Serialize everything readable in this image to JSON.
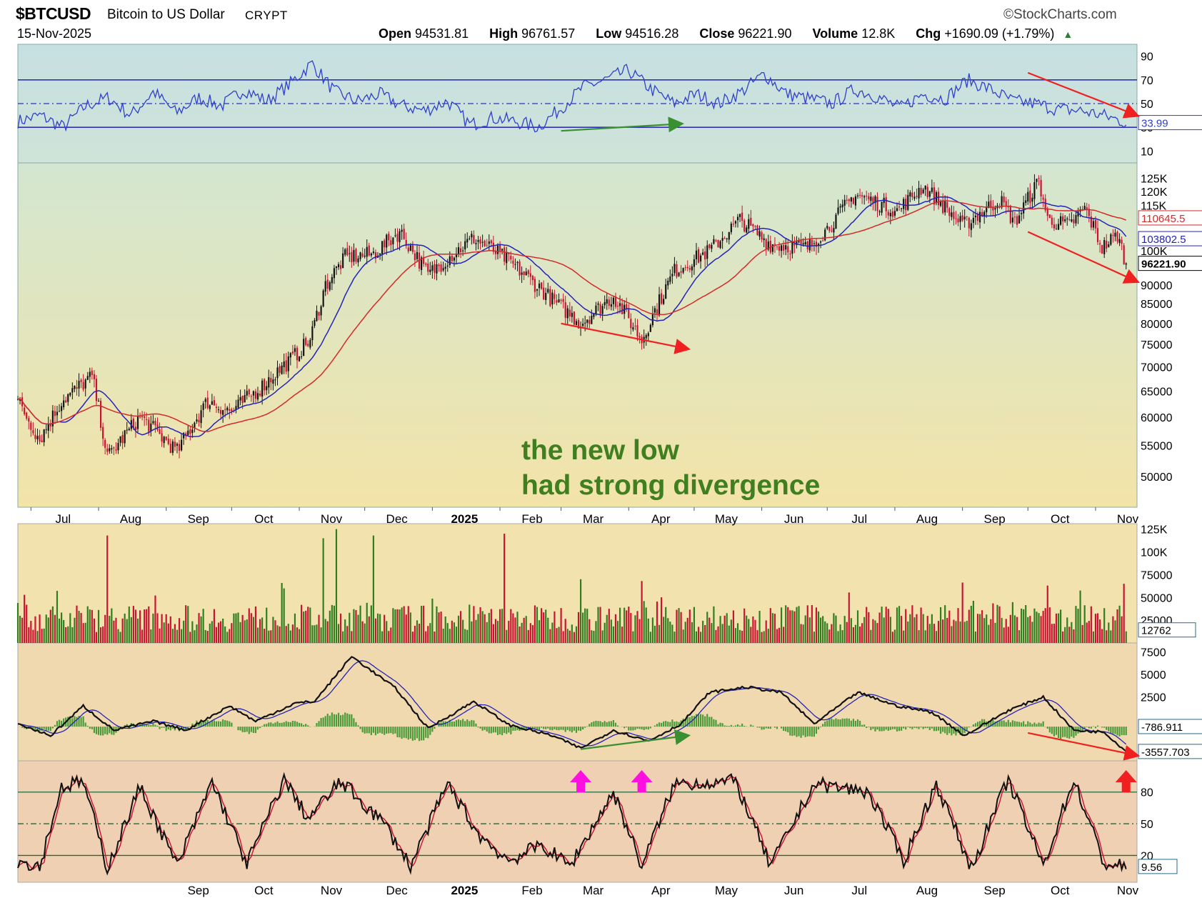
{
  "header": {
    "symbol": "$BTCUSD",
    "description": "Bitcoin to US Dollar",
    "exchange": "CRYPT",
    "date": "15-Nov-2025",
    "brand": "StockCharts.com",
    "open_label": "Open",
    "open": "94531.81",
    "high_label": "High",
    "high": "96761.57",
    "low_label": "Low",
    "low": "94516.28",
    "close_label": "Close",
    "close": "96221.90",
    "volume_label": "Volume",
    "volume": "12.8K",
    "chg_label": "Chg",
    "chg": "+1690.09 (+1.79%)"
  },
  "annotation": [
    "the new low",
    "had strong divergence"
  ],
  "colors": {
    "up": "#2e7d1e",
    "down": "#cc1030",
    "ma_short": "#2424b8",
    "ma_long": "#d42a2a",
    "rsi_line": "#3040c8",
    "arrow_red": "#f02020",
    "arrow_green": "#3a9030",
    "arrow_magenta": "#ff10e0",
    "macd_hist": "#4a9a3a"
  },
  "chart_data": [
    {
      "type": "line",
      "panel": "RSI",
      "ylim": [
        0,
        100
      ],
      "y_ticks": [
        10,
        30,
        50,
        70,
        90
      ],
      "reference_lines": [
        30,
        50,
        70
      ],
      "x": [
        "Jul",
        "Aug",
        "Sep",
        "Oct",
        "Nov",
        "Dec",
        "2025",
        "Feb",
        "Mar",
        "Apr",
        "May",
        "Jun",
        "Jul",
        "Aug",
        "Sep",
        "Oct",
        "Nov"
      ],
      "series": [
        {
          "values": [
            35,
            40,
            30,
            48,
            55,
            40,
            60,
            42,
            55,
            48,
            62,
            52,
            66,
            84,
            60,
            52,
            58,
            48,
            44,
            52,
            32,
            38,
            35,
            30,
            46,
            64,
            70,
            78,
            62,
            50,
            58,
            50,
            60,
            75,
            58,
            54,
            50,
            62,
            56,
            46,
            58,
            54,
            70,
            62,
            52,
            50,
            45,
            44,
            40,
            34
          ]
        }
      ],
      "last_value_label": "33.99",
      "trend_arrows": [
        {
          "color": "green",
          "from": [
            "2025-03-01",
            27
          ],
          "to": [
            "2025-04-25",
            33
          ]
        },
        {
          "color": "red",
          "from": [
            "2025-10-01",
            76
          ],
          "to": [
            "2025-11-20",
            40
          ]
        }
      ]
    },
    {
      "type": "candlestick",
      "panel": "Price",
      "scale": "log",
      "y_ticks": [
        "125K",
        "120K",
        "115K",
        "100K",
        "90000",
        "85000",
        "80000",
        "75000",
        "70000",
        "65000",
        "60000",
        "55000",
        "50000"
      ],
      "x_ticks": [
        "Jul",
        "Aug",
        "Sep",
        "Oct",
        "Nov",
        "Dec",
        "2025",
        "Feb",
        "Mar",
        "Apr",
        "May",
        "Jun",
        "Jul",
        "Aug",
        "Sep",
        "Oct",
        "Nov"
      ],
      "x_range": [
        "2024-06-25",
        "2025-11-20"
      ],
      "close_path": [
        [
          "2024-06-25",
          63000
        ],
        [
          "2024-07-05",
          56000
        ],
        [
          "2024-07-15",
          63000
        ],
        [
          "2024-07-29",
          68000
        ],
        [
          "2024-08-05",
          53000
        ],
        [
          "2024-08-20",
          60000
        ],
        [
          "2024-09-06",
          54000
        ],
        [
          "2024-09-20",
          63000
        ],
        [
          "2024-10-01",
          61000
        ],
        [
          "2024-10-15",
          66000
        ],
        [
          "2024-10-29",
          72000
        ],
        [
          "2024-11-06",
          76000
        ],
        [
          "2024-11-13",
          90000
        ],
        [
          "2024-11-22",
          98000
        ],
        [
          "2024-12-05",
          99000
        ],
        [
          "2024-12-17",
          106000
        ],
        [
          "2024-12-30",
          93000
        ],
        [
          "2025-01-20",
          104000
        ],
        [
          "2025-02-03",
          98000
        ],
        [
          "2025-02-25",
          86000
        ],
        [
          "2025-03-10",
          80000
        ],
        [
          "2025-03-25",
          87000
        ],
        [
          "2025-04-07",
          76000
        ],
        [
          "2025-04-22",
          94000
        ],
        [
          "2025-05-08",
          100000
        ],
        [
          "2025-05-22",
          110000
        ],
        [
          "2025-06-05",
          102000
        ],
        [
          "2025-06-22",
          101000
        ],
        [
          "2025-07-01",
          107000
        ],
        [
          "2025-07-14",
          119000
        ],
        [
          "2025-08-02",
          113000
        ],
        [
          "2025-08-14",
          122000
        ],
        [
          "2025-09-01",
          108000
        ],
        [
          "2025-09-18",
          117000
        ],
        [
          "2025-09-25",
          109000
        ],
        [
          "2025-10-06",
          124000
        ],
        [
          "2025-10-10",
          110000
        ],
        [
          "2025-10-20",
          108000
        ],
        [
          "2025-10-27",
          114000
        ],
        [
          "2025-11-04",
          101000
        ],
        [
          "2025-11-11",
          105000
        ],
        [
          "2025-11-15",
          96221.9
        ]
      ],
      "series": [
        {
          "indicator": "short moving average",
          "last_value_label": "103802.5"
        },
        {
          "indicator": "long moving average",
          "last_value_label": "110645.5"
        }
      ],
      "last_close_label": "96221.90",
      "trend_arrows": [
        {
          "color": "red",
          "from": [
            "2025-03-01",
            80000
          ],
          "to": [
            "2025-04-28",
            74000
          ]
        },
        {
          "color": "red",
          "from": [
            "2025-10-01",
            106000
          ],
          "to": [
            "2025-11-20",
            91000
          ]
        }
      ]
    },
    {
      "type": "bar",
      "panel": "Volume",
      "y_ticks": [
        "125K",
        "100K",
        "75000",
        "50000",
        "25000"
      ],
      "last_value_label": "12762",
      "notable_spikes": [
        [
          "2024-08-05",
          118000
        ],
        [
          "2024-11-12",
          115000
        ],
        [
          "2024-11-18",
          125000
        ],
        [
          "2024-12-05",
          118000
        ],
        [
          "2025-02-03",
          120000
        ],
        [
          "2025-03-10",
          70000
        ],
        [
          "2025-04-07",
          68000
        ],
        [
          "2025-10-10",
          63000
        ],
        [
          "2025-11-14",
          65000
        ]
      ]
    },
    {
      "type": "line",
      "panel": "MACD",
      "y_ticks": [
        "7500",
        "5000",
        "2500"
      ],
      "macd_path": [
        [
          "2024-06-25",
          -500
        ],
        [
          "2024-07-10",
          -1800
        ],
        [
          "2024-07-25",
          1500
        ],
        [
          "2024-08-08",
          -1200
        ],
        [
          "2024-08-26",
          -200
        ],
        [
          "2024-09-10",
          -1200
        ],
        [
          "2024-09-30",
          1500
        ],
        [
          "2024-10-12",
          -200
        ],
        [
          "2024-10-30",
          1800
        ],
        [
          "2024-11-08",
          2000
        ],
        [
          "2024-11-25",
          7000
        ],
        [
          "2024-12-15",
          3500
        ],
        [
          "2024-12-30",
          -1000
        ],
        [
          "2025-01-20",
          2000
        ],
        [
          "2025-02-05",
          -600
        ],
        [
          "2025-02-25",
          -1800
        ],
        [
          "2025-03-10",
          -3200
        ],
        [
          "2025-03-25",
          -1200
        ],
        [
          "2025-04-10",
          -2400
        ],
        [
          "2025-04-25",
          -500
        ],
        [
          "2025-05-08",
          3000
        ],
        [
          "2025-05-25",
          3600
        ],
        [
          "2025-06-10",
          3000
        ],
        [
          "2025-06-25",
          -500
        ],
        [
          "2025-07-15",
          3000
        ],
        [
          "2025-08-02",
          1500
        ],
        [
          "2025-08-18",
          800
        ],
        [
          "2025-09-02",
          -1800
        ],
        [
          "2025-09-22",
          1000
        ],
        [
          "2025-10-08",
          2500
        ],
        [
          "2025-10-22",
          -1200
        ],
        [
          "2025-11-05",
          -1400
        ],
        [
          "2025-11-15",
          -3557.7
        ]
      ],
      "last_value_labels": [
        "-786.911",
        "-3557.703"
      ],
      "trend_arrows": [
        {
          "color": "green",
          "from": [
            "2025-03-10",
            -3300
          ],
          "to": [
            "2025-04-28",
            -1800
          ]
        },
        {
          "color": "red",
          "from": [
            "2025-10-01",
            -1500
          ],
          "to": [
            "2025-11-20",
            -4000
          ]
        }
      ],
      "markers": [
        {
          "type": "up-arrow",
          "color": "magenta",
          "date": "2025-03-10"
        },
        {
          "type": "up-arrow",
          "color": "magenta",
          "date": "2025-04-07"
        },
        {
          "type": "up-arrow",
          "color": "red",
          "date": "2025-11-15"
        }
      ]
    },
    {
      "type": "line",
      "panel": "Stochastic",
      "ylim": [
        0,
        100
      ],
      "y_ticks": [
        20,
        50,
        80
      ],
      "reference_lines": [
        20,
        50,
        80
      ],
      "last_value_label": "9.56",
      "oscillation_path": [
        [
          "2024-06-25",
          15
        ],
        [
          "2024-07-05",
          10
        ],
        [
          "2024-07-15",
          85
        ],
        [
          "2024-07-25",
          90
        ],
        [
          "2024-08-05",
          8
        ],
        [
          "2024-08-20",
          85
        ],
        [
          "2024-09-06",
          10
        ],
        [
          "2024-09-22",
          90
        ],
        [
          "2024-10-08",
          12
        ],
        [
          "2024-10-25",
          92
        ],
        [
          "2024-11-05",
          55
        ],
        [
          "2024-11-20",
          90
        ],
        [
          "2024-12-10",
          50
        ],
        [
          "2024-12-22",
          10
        ],
        [
          "2025-01-08",
          88
        ],
        [
          "2025-01-22",
          40
        ],
        [
          "2025-02-05",
          15
        ],
        [
          "2025-02-20",
          30
        ],
        [
          "2025-03-05",
          10
        ],
        [
          "2025-03-25",
          80
        ],
        [
          "2025-04-07",
          10
        ],
        [
          "2025-04-22",
          88
        ],
        [
          "2025-05-20",
          90
        ],
        [
          "2025-06-05",
          10
        ],
        [
          "2025-06-25",
          88
        ],
        [
          "2025-07-20",
          80
        ],
        [
          "2025-08-05",
          15
        ],
        [
          "2025-08-20",
          88
        ],
        [
          "2025-09-05",
          8
        ],
        [
          "2025-09-22",
          92
        ],
        [
          "2025-10-08",
          10
        ],
        [
          "2025-10-22",
          92
        ],
        [
          "2025-11-05",
          12
        ],
        [
          "2025-11-15",
          9.56
        ]
      ]
    }
  ],
  "bottom_axis": [
    "Sep",
    "Oct",
    "Nov",
    "Dec",
    "2025",
    "Feb",
    "Mar",
    "Apr",
    "May",
    "Jun",
    "Jul",
    "Aug",
    "Sep",
    "Oct",
    "Nov"
  ]
}
